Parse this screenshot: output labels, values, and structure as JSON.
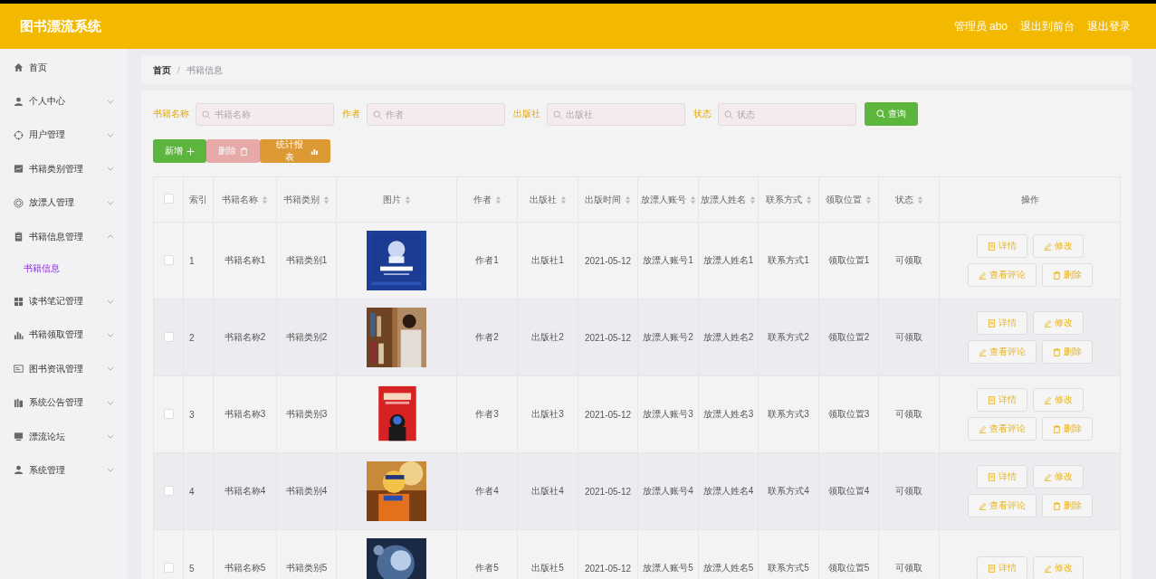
{
  "header": {
    "title": "图书漂流系统",
    "links": [
      "管理员 abo",
      "退出到前台",
      "退出登录"
    ]
  },
  "sidebar": {
    "items": [
      {
        "label": "首页",
        "kind": "link"
      },
      {
        "label": "个人中心",
        "kind": "menu",
        "expanded": false
      },
      {
        "label": "用户管理",
        "kind": "menu",
        "expanded": false
      },
      {
        "label": "书籍类别管理",
        "kind": "menu",
        "expanded": false
      },
      {
        "label": "放漂人管理",
        "kind": "menu",
        "expanded": false
      },
      {
        "label": "书籍信息管理",
        "kind": "menu",
        "expanded": true,
        "children": [
          {
            "label": "书籍信息",
            "selected": true
          }
        ]
      },
      {
        "label": "读书笔记管理",
        "kind": "menu",
        "expanded": false
      },
      {
        "label": "书籍领取管理",
        "kind": "menu",
        "expanded": false
      },
      {
        "label": "图书资讯管理",
        "kind": "menu",
        "expanded": false
      },
      {
        "label": "系统公告管理",
        "kind": "menu",
        "expanded": false
      },
      {
        "label": "漂流论坛",
        "kind": "menu",
        "expanded": false
      },
      {
        "label": "系统管理",
        "kind": "menu",
        "expanded": false
      }
    ]
  },
  "breadcrumb": {
    "items": [
      "首页",
      "书籍信息"
    ],
    "separator": "/"
  },
  "search": [
    {
      "label": "书籍名称",
      "placeholder": "书籍名称"
    },
    {
      "label": "作者",
      "placeholder": "作者"
    },
    {
      "label": "出版社",
      "placeholder": "出版社"
    },
    {
      "label": "状态",
      "placeholder": "状态"
    }
  ],
  "query_button": "查询",
  "toolbar": [
    {
      "label": "新增",
      "kind": "add",
      "disabled": false
    },
    {
      "label": "删除",
      "kind": "delete",
      "disabled": true
    },
    {
      "label": "统计报表",
      "kind": "report",
      "disabled": false
    }
  ],
  "table": {
    "select_all_checked": false,
    "columns": [
      {
        "label": "索引",
        "sortable": false
      },
      {
        "label": "书籍名称",
        "sortable": true
      },
      {
        "label": "书籍类别",
        "sortable": true
      },
      {
        "label": "图片",
        "sortable": true
      },
      {
        "label": "作者",
        "sortable": true
      },
      {
        "label": "出版社",
        "sortable": true
      },
      {
        "label": "出版时间",
        "sortable": true
      },
      {
        "label": "放漂人账号",
        "sortable": true
      },
      {
        "label": "放漂人姓名",
        "sortable": true
      },
      {
        "label": "联系方式",
        "sortable": true
      },
      {
        "label": "领取位置",
        "sortable": true
      },
      {
        "label": "状态",
        "sortable": true
      },
      {
        "label": "操作",
        "sortable": false
      }
    ],
    "rows": [
      {
        "checked": false,
        "cells": [
          "1",
          "书籍名称1",
          "书籍类别1"
        ],
        "image": {
          "kind": "picture"
        },
        "cells2": [
          "作者1",
          "出版社1",
          "2021-05-12",
          "放漂人账号1",
          "放漂人姓名1",
          "联系方式1",
          "领取位置1",
          "可领取"
        ],
        "actions": [
          {
            "label": "详情",
            "kind": "detail"
          },
          {
            "label": "修改",
            "kind": "edit"
          },
          {
            "label": "查看评论",
            "kind": "comment"
          },
          {
            "label": "删除",
            "kind": "delete"
          }
        ]
      },
      {
        "checked": false,
        "cells": [
          "2",
          "书籍名称2",
          "书籍类别2"
        ],
        "image": {
          "kind": "picture"
        },
        "cells2": [
          "作者2",
          "出版社2",
          "2021-05-12",
          "放漂人账号2",
          "放漂人姓名2",
          "联系方式2",
          "领取位置2",
          "可领取"
        ],
        "actions": [
          {
            "label": "详情",
            "kind": "detail"
          },
          {
            "label": "修改",
            "kind": "edit"
          },
          {
            "label": "查看评论",
            "kind": "comment"
          },
          {
            "label": "删除",
            "kind": "delete"
          }
        ]
      },
      {
        "checked": false,
        "cells": [
          "3",
          "书籍名称3",
          "书籍类别3"
        ],
        "image": {
          "kind": "picture"
        },
        "cells2": [
          "作者3",
          "出版社3",
          "2021-05-12",
          "放漂人账号3",
          "放漂人姓名3",
          "联系方式3",
          "领取位置3",
          "可领取"
        ],
        "actions": [
          {
            "label": "详情",
            "kind": "detail"
          },
          {
            "label": "修改",
            "kind": "edit"
          },
          {
            "label": "查看评论",
            "kind": "comment"
          },
          {
            "label": "删除",
            "kind": "delete"
          }
        ]
      },
      {
        "checked": false,
        "cells": [
          "4",
          "书籍名称4",
          "书籍类别4"
        ],
        "image": {
          "kind": "picture"
        },
        "cells2": [
          "作者4",
          "出版社4",
          "2021-05-12",
          "放漂人账号4",
          "放漂人姓名4",
          "联系方式4",
          "领取位置4",
          "可领取"
        ],
        "actions": [
          {
            "label": "详情",
            "kind": "detail"
          },
          {
            "label": "修改",
            "kind": "edit"
          },
          {
            "label": "查看评论",
            "kind": "comment"
          },
          {
            "label": "删除",
            "kind": "delete"
          }
        ]
      },
      {
        "checked": false,
        "cells": [
          "5",
          "书籍名称5",
          "书籍类别5"
        ],
        "image": {
          "kind": "picture"
        },
        "cells2": [
          "作者5",
          "出版社5",
          "2021-05-12",
          "放漂人账号5",
          "放漂人姓名5",
          "联系方式5",
          "领取位置5",
          "可领取"
        ],
        "actions": [
          {
            "label": "详情",
            "kind": "detail"
          },
          {
            "label": "修改",
            "kind": "edit"
          }
        ]
      }
    ]
  }
}
